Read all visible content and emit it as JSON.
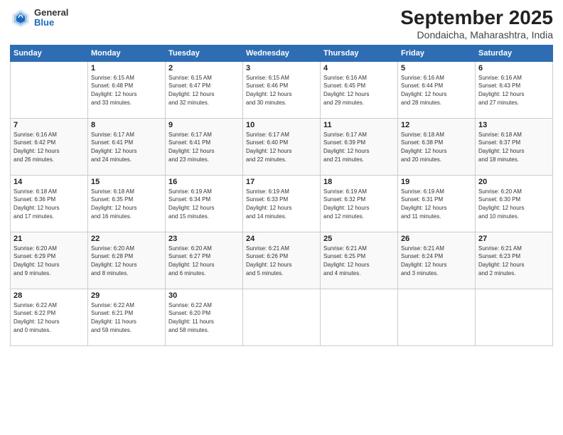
{
  "header": {
    "logo_general": "General",
    "logo_blue": "Blue",
    "month_title": "September 2025",
    "subtitle": "Dondaicha, Maharashtra, India"
  },
  "days_of_week": [
    "Sunday",
    "Monday",
    "Tuesday",
    "Wednesday",
    "Thursday",
    "Friday",
    "Saturday"
  ],
  "weeks": [
    [
      {
        "day": "",
        "info": ""
      },
      {
        "day": "1",
        "info": "Sunrise: 6:15 AM\nSunset: 6:48 PM\nDaylight: 12 hours\nand 33 minutes."
      },
      {
        "day": "2",
        "info": "Sunrise: 6:15 AM\nSunset: 6:47 PM\nDaylight: 12 hours\nand 32 minutes."
      },
      {
        "day": "3",
        "info": "Sunrise: 6:15 AM\nSunset: 6:46 PM\nDaylight: 12 hours\nand 30 minutes."
      },
      {
        "day": "4",
        "info": "Sunrise: 6:16 AM\nSunset: 6:45 PM\nDaylight: 12 hours\nand 29 minutes."
      },
      {
        "day": "5",
        "info": "Sunrise: 6:16 AM\nSunset: 6:44 PM\nDaylight: 12 hours\nand 28 minutes."
      },
      {
        "day": "6",
        "info": "Sunrise: 6:16 AM\nSunset: 6:43 PM\nDaylight: 12 hours\nand 27 minutes."
      }
    ],
    [
      {
        "day": "7",
        "info": "Sunrise: 6:16 AM\nSunset: 6:42 PM\nDaylight: 12 hours\nand 26 minutes."
      },
      {
        "day": "8",
        "info": "Sunrise: 6:17 AM\nSunset: 6:41 PM\nDaylight: 12 hours\nand 24 minutes."
      },
      {
        "day": "9",
        "info": "Sunrise: 6:17 AM\nSunset: 6:41 PM\nDaylight: 12 hours\nand 23 minutes."
      },
      {
        "day": "10",
        "info": "Sunrise: 6:17 AM\nSunset: 6:40 PM\nDaylight: 12 hours\nand 22 minutes."
      },
      {
        "day": "11",
        "info": "Sunrise: 6:17 AM\nSunset: 6:39 PM\nDaylight: 12 hours\nand 21 minutes."
      },
      {
        "day": "12",
        "info": "Sunrise: 6:18 AM\nSunset: 6:38 PM\nDaylight: 12 hours\nand 20 minutes."
      },
      {
        "day": "13",
        "info": "Sunrise: 6:18 AM\nSunset: 6:37 PM\nDaylight: 12 hours\nand 18 minutes."
      }
    ],
    [
      {
        "day": "14",
        "info": "Sunrise: 6:18 AM\nSunset: 6:36 PM\nDaylight: 12 hours\nand 17 minutes."
      },
      {
        "day": "15",
        "info": "Sunrise: 6:18 AM\nSunset: 6:35 PM\nDaylight: 12 hours\nand 16 minutes."
      },
      {
        "day": "16",
        "info": "Sunrise: 6:19 AM\nSunset: 6:34 PM\nDaylight: 12 hours\nand 15 minutes."
      },
      {
        "day": "17",
        "info": "Sunrise: 6:19 AM\nSunset: 6:33 PM\nDaylight: 12 hours\nand 14 minutes."
      },
      {
        "day": "18",
        "info": "Sunrise: 6:19 AM\nSunset: 6:32 PM\nDaylight: 12 hours\nand 12 minutes."
      },
      {
        "day": "19",
        "info": "Sunrise: 6:19 AM\nSunset: 6:31 PM\nDaylight: 12 hours\nand 11 minutes."
      },
      {
        "day": "20",
        "info": "Sunrise: 6:20 AM\nSunset: 6:30 PM\nDaylight: 12 hours\nand 10 minutes."
      }
    ],
    [
      {
        "day": "21",
        "info": "Sunrise: 6:20 AM\nSunset: 6:29 PM\nDaylight: 12 hours\nand 9 minutes."
      },
      {
        "day": "22",
        "info": "Sunrise: 6:20 AM\nSunset: 6:28 PM\nDaylight: 12 hours\nand 8 minutes."
      },
      {
        "day": "23",
        "info": "Sunrise: 6:20 AM\nSunset: 6:27 PM\nDaylight: 12 hours\nand 6 minutes."
      },
      {
        "day": "24",
        "info": "Sunrise: 6:21 AM\nSunset: 6:26 PM\nDaylight: 12 hours\nand 5 minutes."
      },
      {
        "day": "25",
        "info": "Sunrise: 6:21 AM\nSunset: 6:25 PM\nDaylight: 12 hours\nand 4 minutes."
      },
      {
        "day": "26",
        "info": "Sunrise: 6:21 AM\nSunset: 6:24 PM\nDaylight: 12 hours\nand 3 minutes."
      },
      {
        "day": "27",
        "info": "Sunrise: 6:21 AM\nSunset: 6:23 PM\nDaylight: 12 hours\nand 2 minutes."
      }
    ],
    [
      {
        "day": "28",
        "info": "Sunrise: 6:22 AM\nSunset: 6:22 PM\nDaylight: 12 hours\nand 0 minutes."
      },
      {
        "day": "29",
        "info": "Sunrise: 6:22 AM\nSunset: 6:21 PM\nDaylight: 11 hours\nand 59 minutes."
      },
      {
        "day": "30",
        "info": "Sunrise: 6:22 AM\nSunset: 6:20 PM\nDaylight: 11 hours\nand 58 minutes."
      },
      {
        "day": "",
        "info": ""
      },
      {
        "day": "",
        "info": ""
      },
      {
        "day": "",
        "info": ""
      },
      {
        "day": "",
        "info": ""
      }
    ]
  ]
}
